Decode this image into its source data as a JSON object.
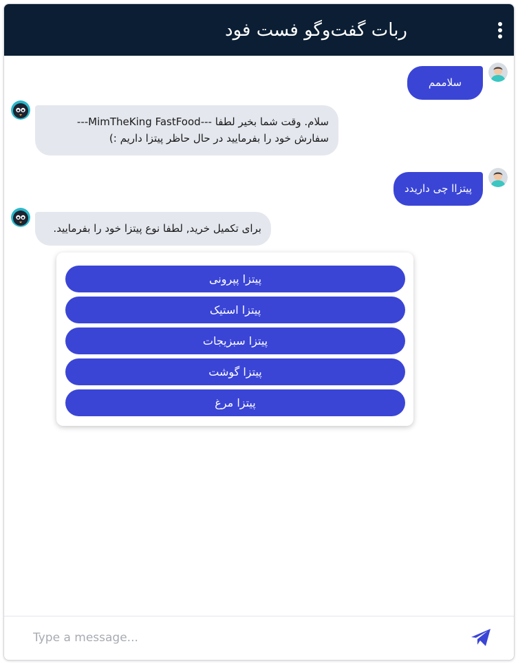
{
  "header": {
    "title": "ربات گفت‌وگو فست فود",
    "menu_icon": "more-vertical-icon"
  },
  "messages": [
    {
      "sender": "user",
      "lines": [
        "سلاممم"
      ],
      "avatar_icon": "user-avatar"
    },
    {
      "sender": "bot",
      "lines": [
        "سلام. وقت شما بخیر لطفا ---MimTheKing FastFood---",
        "سفارش خود را بفرمایید در حال حاظر پیتزا داریم :)"
      ],
      "avatar_icon": "bot-avatar"
    },
    {
      "sender": "user",
      "lines": [
        "پیتزاا چی داریدد"
      ],
      "avatar_icon": "user-avatar"
    },
    {
      "sender": "bot",
      "lines": [
        "برای تکمیل خرید, لطفا نوع پیتزا خود را بفرمایید."
      ],
      "avatar_icon": "bot-avatar"
    }
  ],
  "options": [
    "پیتزا پپرونی",
    "پیتزا استیک",
    "پیتزا سبزیجات",
    "پیتزا گوشت",
    "پیتزا مرغ"
  ],
  "composer": {
    "placeholder": "Type a message...",
    "value": "",
    "send_icon": "send-icon"
  },
  "colors": {
    "header_bg": "#0b1e33",
    "accent": "#3a45d6",
    "bot_bubble": "#e4e7ee"
  }
}
